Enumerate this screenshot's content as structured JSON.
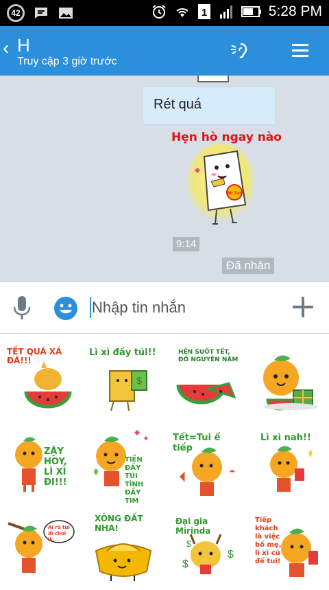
{
  "status_bar": {
    "notification_count": "42",
    "time": "5:28 PM",
    "sim_slot": "1"
  },
  "header": {
    "title": "H",
    "subtitle": "Truy cập 3 giờ trước"
  },
  "chat": {
    "text_message": "Rét quá",
    "sticker_caption": "Hẹn hò ngay nào",
    "sticker_brand": "Mr Teo",
    "timestamp": "9:14",
    "status": "Đã nhận"
  },
  "composer": {
    "placeholder": "Nhập tin nhắn"
  },
  "sticker_panel": {
    "stickers": [
      "TẾT QUÁ XÁ ĐÃ!!!",
      "Lì xì đầy túi!!",
      "HẾN SUỐT TẾT, ĐỎ NGUYÊN NĂM",
      "",
      "ZẬY HOY, LÌ XÌ ĐI!!!",
      "TIỀN ĐẦY TÚI TÌNH ĐẦY TIM",
      "Tết=Tui ế tiếp",
      "Lì xì nah!!",
      "Ai rủ tui đi chơi ik...",
      "XÔNG ĐẤT NHA!",
      "Đại gia Mirinda",
      "Tiếp khách là việc bố mẹ, lì xì cứ để tui!"
    ]
  },
  "colors": {
    "accent": "#2b8fdc",
    "chat_bg": "#d7dee6",
    "bubble": "#d7ecfb",
    "sticker_red": "#e0121a"
  }
}
